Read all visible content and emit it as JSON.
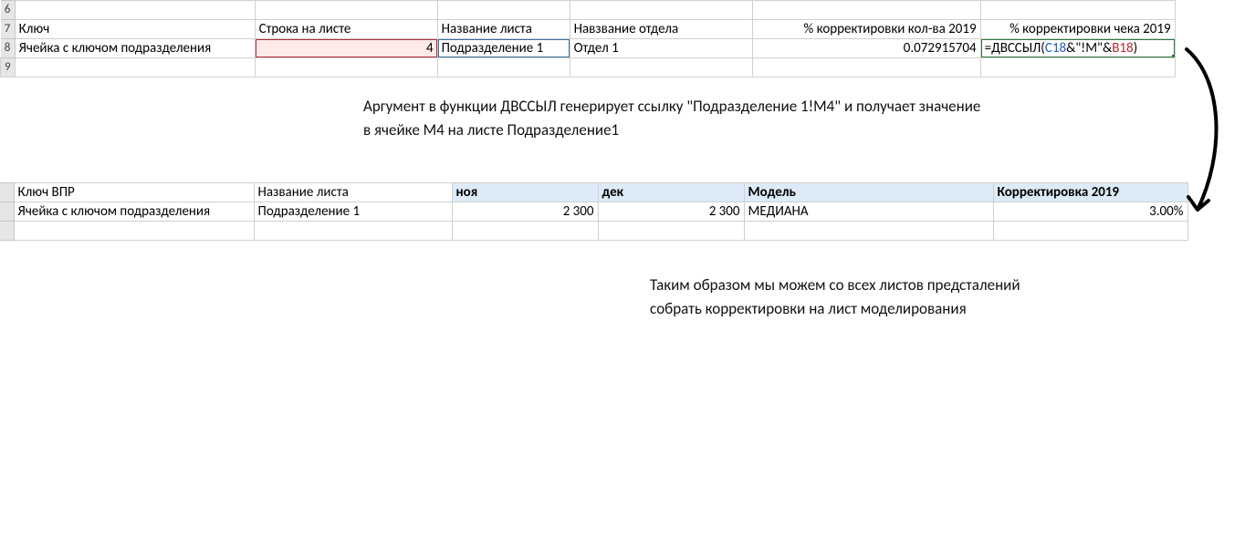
{
  "rows_visible": [
    "6",
    "7",
    "8",
    "9"
  ],
  "table1": {
    "headers": {
      "colA": "Ключ",
      "colB": "Строка на листе",
      "colC": "Название листа",
      "colD": "Навзвание отдела",
      "colE": "% корректировки кол-ва 2019",
      "colF": "% корректировки чека 2019"
    },
    "row8": {
      "colA": "Ячейка с ключом подразделения",
      "colB": "4",
      "colC": "Подразделение 1",
      "colD": "Отдел 1",
      "colE": "0.072915704",
      "formula": {
        "prefix": "=ДВССЫЛ(",
        "ref1": "C18",
        "mid": "&\"!M\"&",
        "ref2": "B18",
        "suffix": ")"
      }
    }
  },
  "annotation1": {
    "line1": "Аргумент в функции ДВССЫЛ генерирует ссылку \"Подразделение 1!M4\" и получает значение",
    "line2": "в ячейке M4 на листе Подразделение1"
  },
  "table2": {
    "headers": {
      "colA": "Ключ ВПР",
      "colB": "Название листа",
      "colC": "ноя",
      "colD": "дек",
      "colE": "Модель",
      "colF": "Корректировка 2019"
    },
    "row": {
      "colA": "Ячейка с ключом подразделения",
      "colB": "Подразделение 1",
      "colC": "2 300",
      "colD": "2 300",
      "colE": "МЕДИАНА",
      "colF": "3.00%"
    }
  },
  "annotation2": {
    "line1": "Таким образом мы можем со всех листов предсталений",
    "line2": "собрать корректировки на лист моделирования"
  }
}
